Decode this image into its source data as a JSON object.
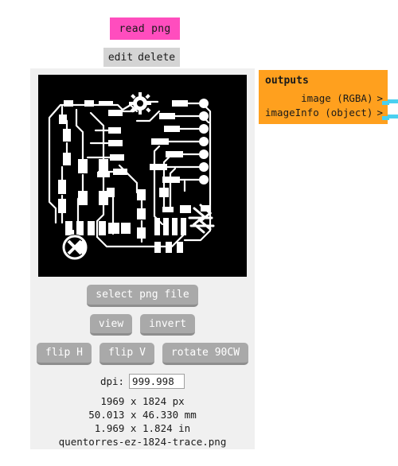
{
  "colors": {
    "node_header_pink": "#ff4dbe",
    "node_actions_gray": "#d4d4d4",
    "node_body_gray": "#f0f0f0",
    "button_gray": "#a9a9a9",
    "outputs_orange": "#ffa01e",
    "wire_cyan": "#4ad0f0",
    "preview_background": "#000000",
    "preview_trace": "#ffffff"
  },
  "node": {
    "title": "read png",
    "actions": [
      {
        "label": "edit",
        "name": "edit-action"
      },
      {
        "label": "delete",
        "name": "delete-action"
      }
    ]
  },
  "preview": {
    "alt": "pcb-trace-preview",
    "description": "PCB copper trace artwork, white traces on black background"
  },
  "controls": {
    "rows": [
      [
        {
          "label": "select png file",
          "name": "select-png-file-button"
        }
      ],
      [
        {
          "label": "view",
          "name": "view-button"
        },
        {
          "label": "invert",
          "name": "invert-button"
        }
      ],
      [
        {
          "label": "flip H",
          "name": "flip-horizontal-button"
        },
        {
          "label": "flip V",
          "name": "flip-vertical-button"
        },
        {
          "label": "rotate 90CW",
          "name": "rotate-90cw-button"
        }
      ]
    ]
  },
  "dpi": {
    "label": "dpi:",
    "value": "999.998",
    "placeholder": "dpi"
  },
  "info": {
    "lines": [
      "1969 x 1824 px",
      "50.013 x 46.330 mm",
      "1.969 x 1.824 in",
      "quentorres-ez-1824-trace.png"
    ]
  },
  "outputs": {
    "title": "outputs",
    "ports": [
      {
        "label": "image (RGBA)",
        "caret": ">",
        "name": "output-port-image"
      },
      {
        "label": "imageInfo (object)",
        "caret": ">",
        "name": "output-port-imageinfo"
      }
    ]
  }
}
